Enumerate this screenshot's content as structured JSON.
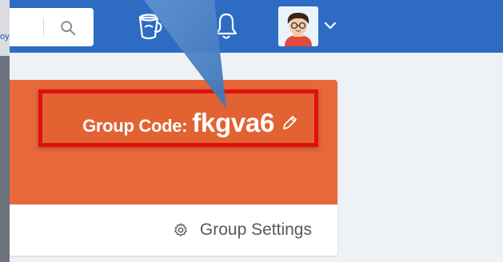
{
  "sidebar_edge": {
    "text": "oy"
  },
  "navbar": {
    "search": {
      "placeholder": "",
      "icon": "search-icon"
    },
    "icons": [
      "cup-icon",
      "bell-icon",
      "chevron-down-icon"
    ],
    "avatar": {
      "icon": "avatar-icon"
    }
  },
  "group_card": {
    "code_label": "Group Code:",
    "code_value": "fkgva6",
    "edit_icon": "pencil-icon",
    "settings_label": "Group Settings",
    "settings_icon": "gear-icon"
  },
  "colors": {
    "navbar": "#2d6cc2",
    "card_header": "#e8683a",
    "highlight_border": "#e01010",
    "arrow": "#4f86c6"
  }
}
